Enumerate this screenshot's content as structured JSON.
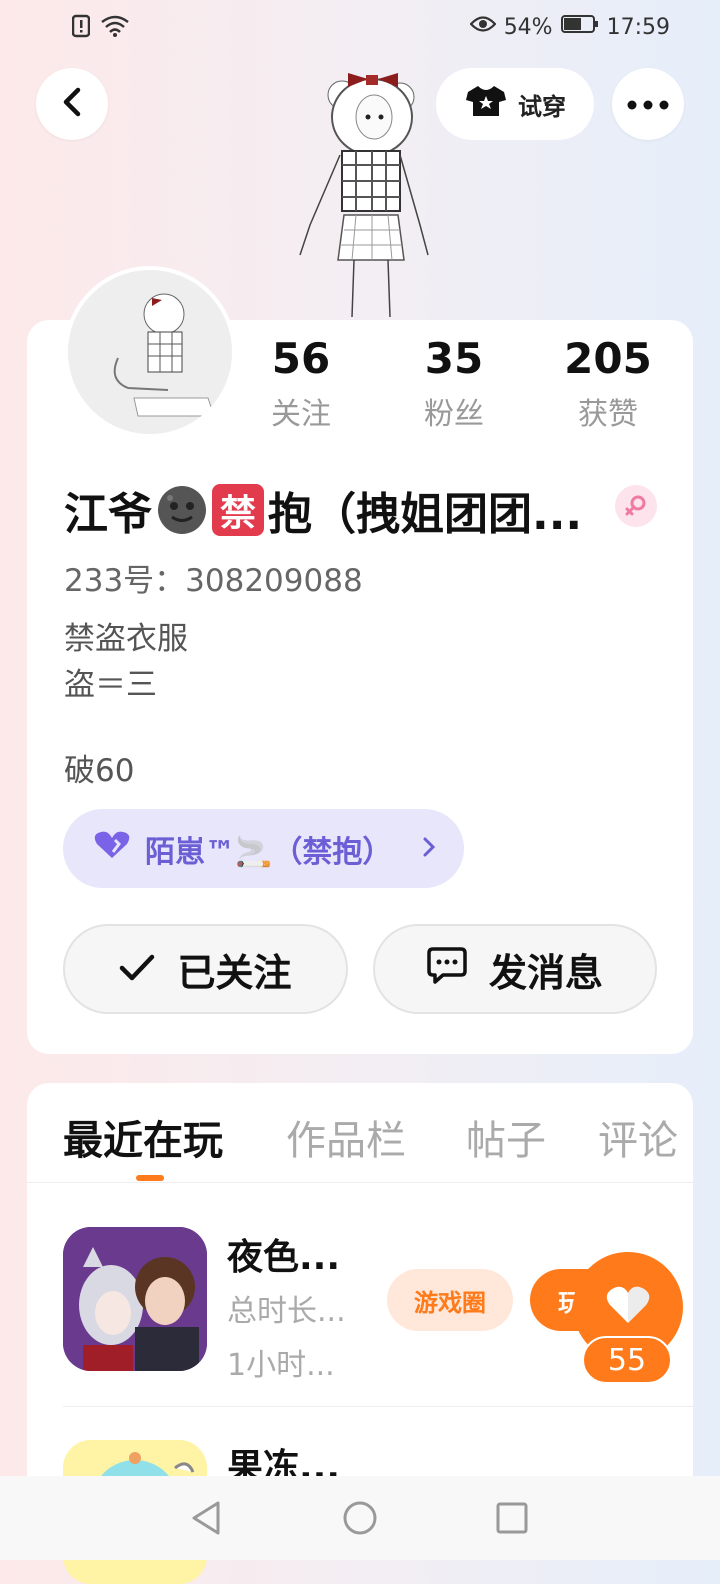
{
  "status_bar": {
    "battery": "54%",
    "time": "17:59"
  },
  "header": {
    "try_on_label": "试穿"
  },
  "profile": {
    "stats": [
      {
        "value": "56",
        "label": "关注"
      },
      {
        "value": "35",
        "label": "粉丝"
      },
      {
        "value": "205",
        "label": "获赞"
      }
    ],
    "name_prefix": "江爷",
    "name_mid_badge": "禁",
    "name_suffix": "抱（拽姐团团...",
    "uid": "233号：308209088",
    "bio_line1": "禁盗衣服",
    "bio_line2": "盗＝三",
    "bio_line3": "破60",
    "group_pill": "陌崽™🚬（禁抱）",
    "follow_label": "已关注",
    "message_label": "发消息"
  },
  "tabs": [
    "最近在玩",
    "作品栏",
    "帖子",
    "评论"
  ],
  "games": [
    {
      "title": "夜色...",
      "meta1": "总时长...",
      "meta2": "1小时...",
      "circle_label": "游戏圈",
      "play_label": "玩"
    },
    {
      "title": "果冻..."
    }
  ],
  "like_count": "55",
  "colors": {
    "accent": "#ff7a1a",
    "pill_bg": "#e7e6fb",
    "pill_text": "#6c5fd6"
  }
}
